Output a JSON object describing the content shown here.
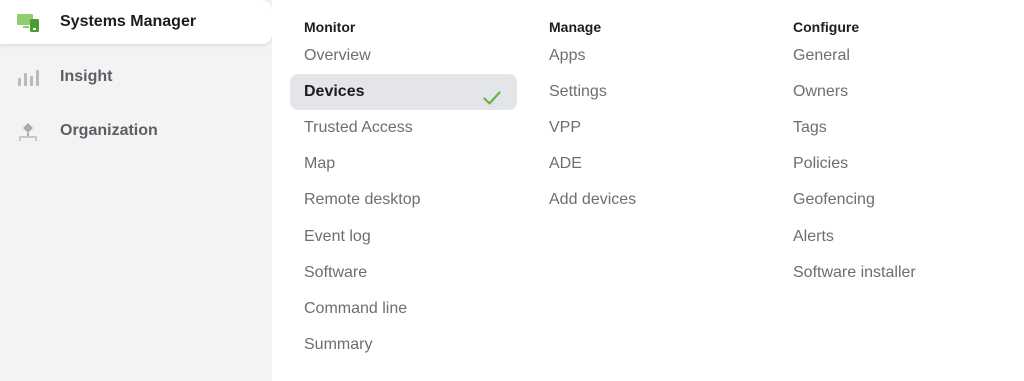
{
  "sidebar": {
    "items": [
      {
        "label": "Systems Manager",
        "icon": "devices-icon",
        "active": true
      },
      {
        "label": "Insight",
        "icon": "bar-chart-icon",
        "active": false
      },
      {
        "label": "Organization",
        "icon": "org-icon",
        "active": false
      }
    ]
  },
  "menu": {
    "monitor": {
      "heading": "Monitor",
      "items": [
        "Overview",
        "Devices",
        "Trusted Access",
        "Map",
        "Remote desktop",
        "Event log",
        "Software",
        "Command line",
        "Summary"
      ],
      "selected": "Devices"
    },
    "manage": {
      "heading": "Manage",
      "items": [
        "Apps",
        "Settings",
        "VPP",
        "ADE",
        "Add devices"
      ]
    },
    "configure": {
      "heading": "Configure",
      "items": [
        "General",
        "Owners",
        "Tags",
        "Policies",
        "Geofencing",
        "Alerts",
        "Software installer"
      ]
    }
  },
  "colors": {
    "accent": "#67b346",
    "selected_bg": "#e3e5e8",
    "sidebar_bg": "#f3f3f4"
  }
}
